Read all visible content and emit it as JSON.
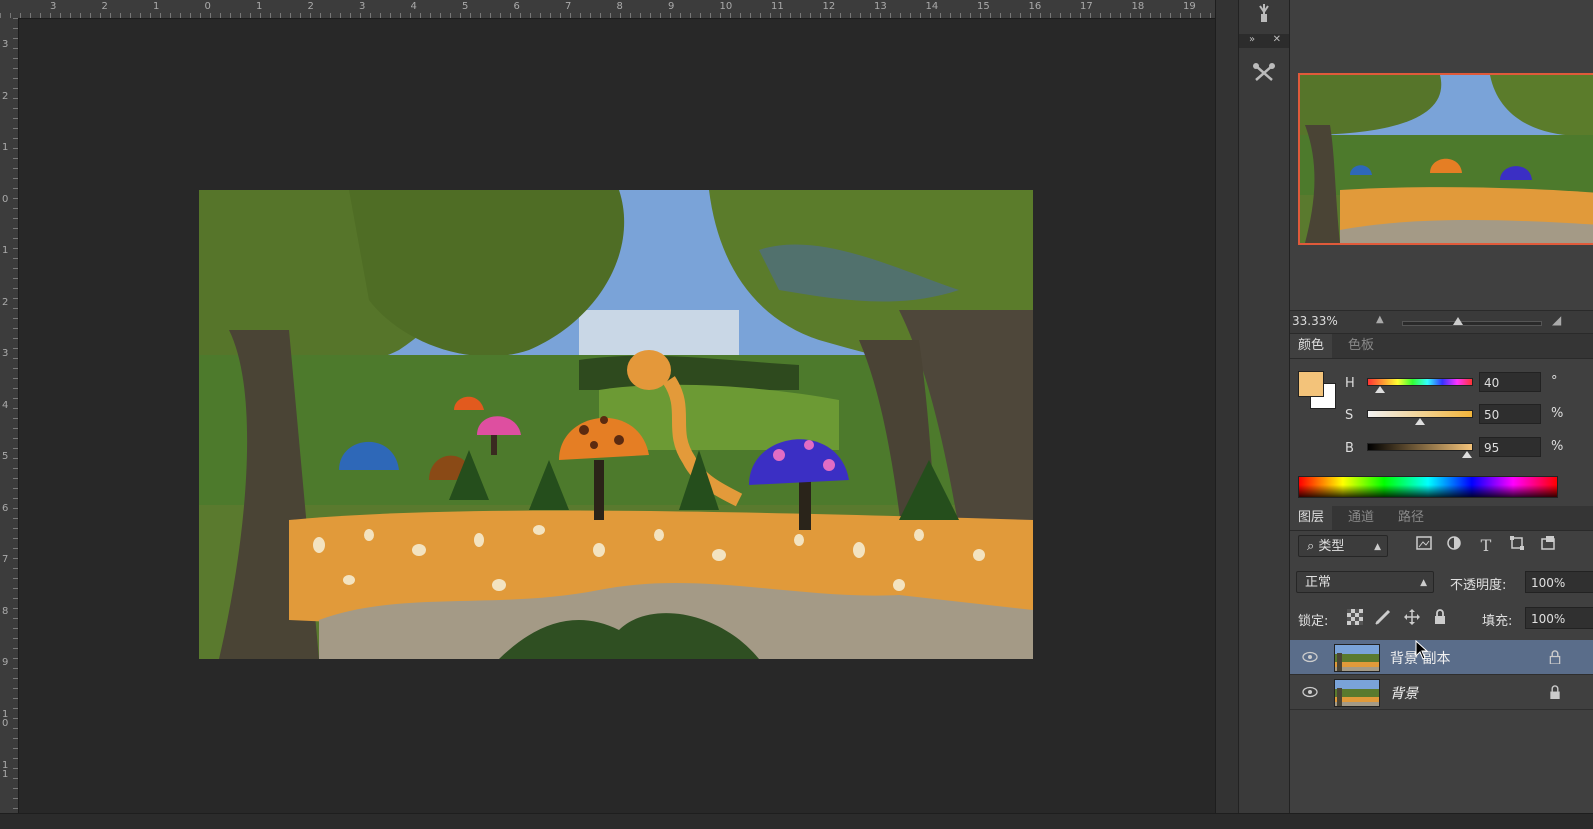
{
  "rulers": {
    "top": [
      "3",
      "2",
      "1",
      "0",
      "1",
      "2",
      "3",
      "4",
      "5",
      "6",
      "7",
      "8",
      "9",
      "10",
      "11",
      "12",
      "13",
      "14",
      "15",
      "16",
      "17",
      "18",
      "19"
    ],
    "left": [
      "3",
      "2",
      "1",
      "0",
      "1",
      "2",
      "3",
      "4",
      "5",
      "6",
      "7",
      "8",
      "9",
      "1\n0",
      "1\n1"
    ]
  },
  "navigator": {
    "zoom": "33.33%"
  },
  "color_panel": {
    "tabs": [
      "颜色",
      "色板"
    ],
    "foreground": "#f3c37a",
    "background": "#ffffff",
    "h": {
      "label": "H",
      "value": "40",
      "unit": "°"
    },
    "s": {
      "label": "S",
      "value": "50",
      "unit": "%"
    },
    "b": {
      "label": "B",
      "value": "95",
      "unit": "%"
    }
  },
  "layers_panel": {
    "tabs": [
      "图层",
      "通道",
      "路径"
    ],
    "filter_label": "类型",
    "blend_mode": "正常",
    "opacity_label": "不透明度:",
    "opacity_value": "100%",
    "lock_label": "锁定:",
    "fill_label": "填充:",
    "fill_value": "100%",
    "layers": [
      {
        "name": "背景 副本",
        "selected": true
      },
      {
        "name": "背景",
        "selected": false
      }
    ]
  },
  "colors": {
    "selection": "#5a6d8a",
    "navigator_frame": "#e05a3a"
  }
}
